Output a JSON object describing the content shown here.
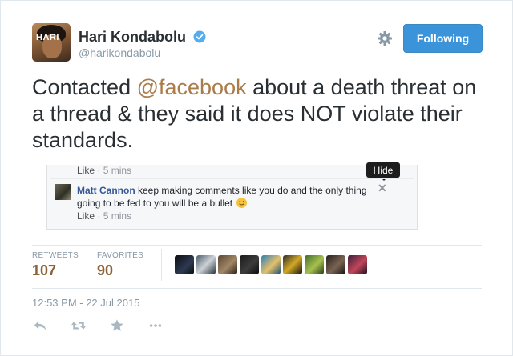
{
  "user": {
    "name": "Hari Kondabolu",
    "handle": "@harikondabolu",
    "avatar_text": "HARI"
  },
  "header": {
    "follow_label": "Following"
  },
  "tweet": {
    "text_before": "Contacted ",
    "mention": "@facebook",
    "text_after": " about a death threat on a thread & they said it does NOT violate their standards."
  },
  "embed": {
    "like_label": "Like",
    "separator": "·",
    "time_top": "5 mins",
    "tooltip": "Hide",
    "comment_author": "Matt Cannon",
    "comment_text": "keep making comments like you do and the only thing going to be fed to you will be a bullet",
    "time_bottom": "5 mins"
  },
  "stats": {
    "retweets_label": "RETWEETS",
    "retweets_value": "107",
    "favorites_label": "FAVORITES",
    "favorites_value": "90"
  },
  "timestamp": "12:53 PM - 22 Jul 2015",
  "colors": {
    "follow_button": "#3b94d9",
    "link": "#aa7c4a",
    "muted": "#8899a6"
  },
  "icons": [
    "verified-badge-icon",
    "gear-icon",
    "reply-icon",
    "retweet-icon",
    "favorite-icon",
    "more-icon"
  ]
}
